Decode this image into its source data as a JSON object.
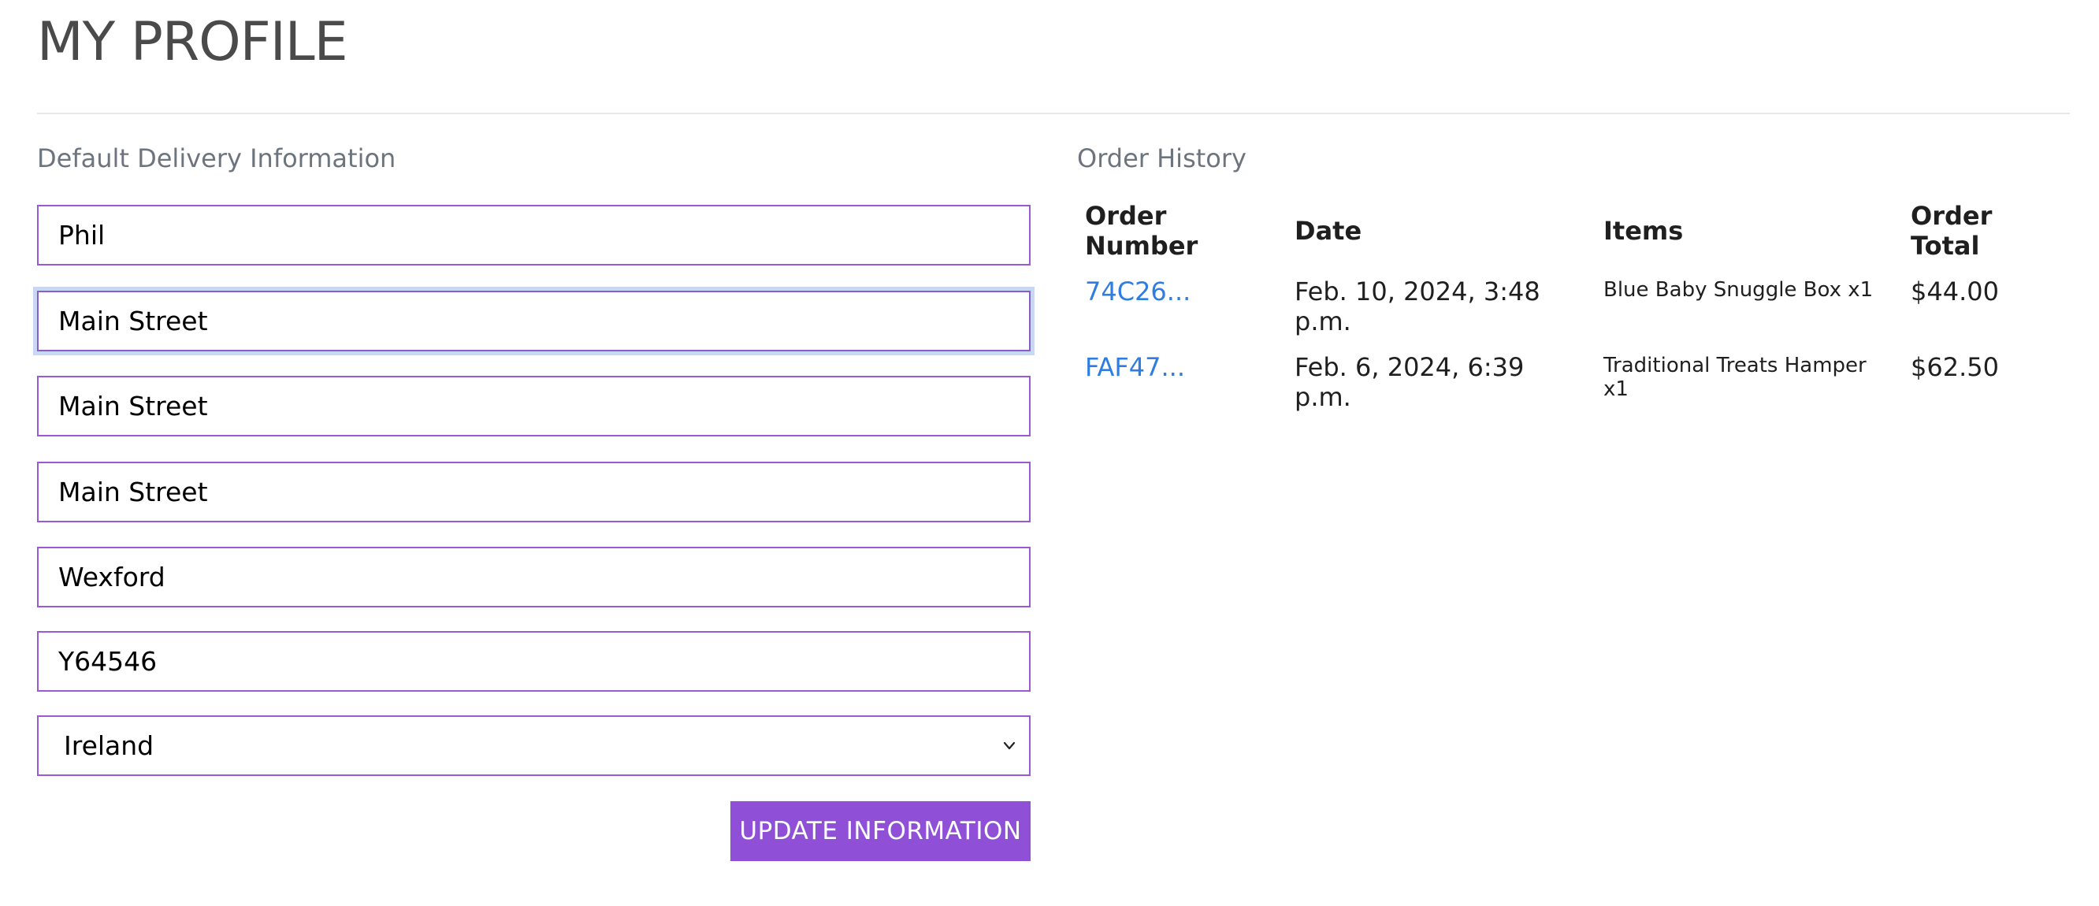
{
  "page": {
    "title": "MY PROFILE"
  },
  "delivery": {
    "heading": "Default Delivery Information",
    "fields": [
      {
        "name": "full-name",
        "value": "Phil"
      },
      {
        "name": "street-address-1",
        "value": "Main Street"
      },
      {
        "name": "street-address-2",
        "value": "Main Street"
      },
      {
        "name": "town-or-city",
        "value": "Main Street"
      },
      {
        "name": "county",
        "value": "Wexford"
      },
      {
        "name": "postcode",
        "value": "Y64546"
      }
    ],
    "country": "Ireland",
    "button_label": "UPDATE INFORMATION"
  },
  "orders": {
    "heading": "Order History",
    "columns": [
      "Order Number",
      "Date",
      "Items",
      "Order Total"
    ],
    "rows": [
      {
        "number": "74C26...",
        "date": "Feb. 10, 2024, 3:48 p.m.",
        "items": "Blue Baby Snuggle Box x1",
        "total": "$44.00"
      },
      {
        "number": "FAF47...",
        "date": "Feb. 6, 2024, 6:39 p.m.",
        "items": "Traditional Treats Hamper x1",
        "total": "$62.50"
      }
    ]
  },
  "colors": {
    "accent": "#8f4fd6",
    "field_border": "#9a5ad6",
    "link": "#2f7de1",
    "heading_grey": "#6c757d",
    "focus_ring": "#c9d7f3"
  },
  "icons": {
    "select": "chevron-down-icon"
  }
}
